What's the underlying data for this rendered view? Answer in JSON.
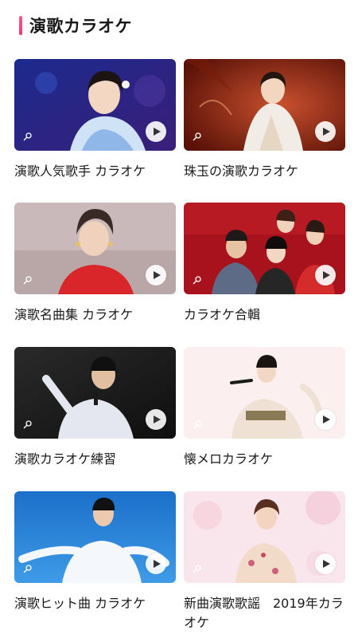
{
  "header": {
    "title": "演歌カラオケ",
    "accent_color": "#f0357a"
  },
  "cards": [
    {
      "title": "演歌人気歌手 カラオケ",
      "icons": [
        "microphone-icon",
        "play-icon"
      ]
    },
    {
      "title": "珠玉の演歌カラオケ",
      "icons": [
        "microphone-icon",
        "play-icon"
      ]
    },
    {
      "title": "演歌名曲集 カラオケ",
      "icons": [
        "microphone-icon",
        "play-icon"
      ]
    },
    {
      "title": "カラオケ合輯",
      "icons": [
        "microphone-icon",
        "play-icon"
      ]
    },
    {
      "title": "演歌カラオケ練習",
      "icons": [
        "microphone-icon",
        "play-icon"
      ]
    },
    {
      "title": "懐メロカラオケ",
      "icons": [
        "microphone-icon",
        "play-icon"
      ]
    },
    {
      "title": "演歌ヒット曲 カラオケ",
      "icons": [
        "microphone-icon",
        "play-icon"
      ]
    },
    {
      "title": "新曲演歌歌謡　2019年カラオケ",
      "icons": [
        "microphone-icon",
        "play-icon"
      ]
    }
  ]
}
